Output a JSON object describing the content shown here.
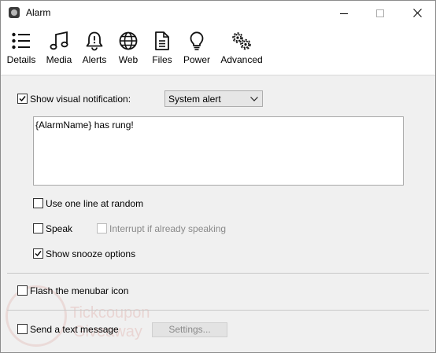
{
  "window": {
    "title": "Alarm",
    "app_icon": "alarm-app-icon",
    "controls": [
      "minimize-icon",
      "maximize-icon",
      "close-icon"
    ]
  },
  "toolbar": {
    "items": [
      {
        "label": "Details",
        "icon": "list-icon"
      },
      {
        "label": "Media",
        "icon": "music-note-icon"
      },
      {
        "label": "Alerts",
        "icon": "bell-icon"
      },
      {
        "label": "Web",
        "icon": "globe-icon"
      },
      {
        "label": "Files",
        "icon": "document-icon"
      },
      {
        "label": "Power",
        "icon": "lightbulb-icon"
      },
      {
        "label": "Advanced",
        "icon": "gears-icon"
      }
    ]
  },
  "alerts": {
    "show_visual_notification": {
      "label": "Show visual notification:",
      "checked": true
    },
    "notification_type": {
      "selected": "System alert"
    },
    "message_text": "{AlarmName} has rung!",
    "use_one_line": {
      "label": "Use one line at random",
      "checked": false
    },
    "speak": {
      "label": "Speak",
      "checked": false
    },
    "interrupt_speaking": {
      "label": "Interrupt if already speaking",
      "checked": false,
      "enabled": false
    },
    "show_snooze": {
      "label": "Show snooze options",
      "checked": true
    },
    "flash_menubar": {
      "label": "Flash the menubar icon",
      "checked": false
    },
    "send_text": {
      "label": "Send a text message",
      "checked": false
    },
    "settings_button": {
      "label": "Settings...",
      "enabled": false
    }
  },
  "watermark": {
    "line1": "Tickcoupon",
    "line2": "Giveaway"
  }
}
